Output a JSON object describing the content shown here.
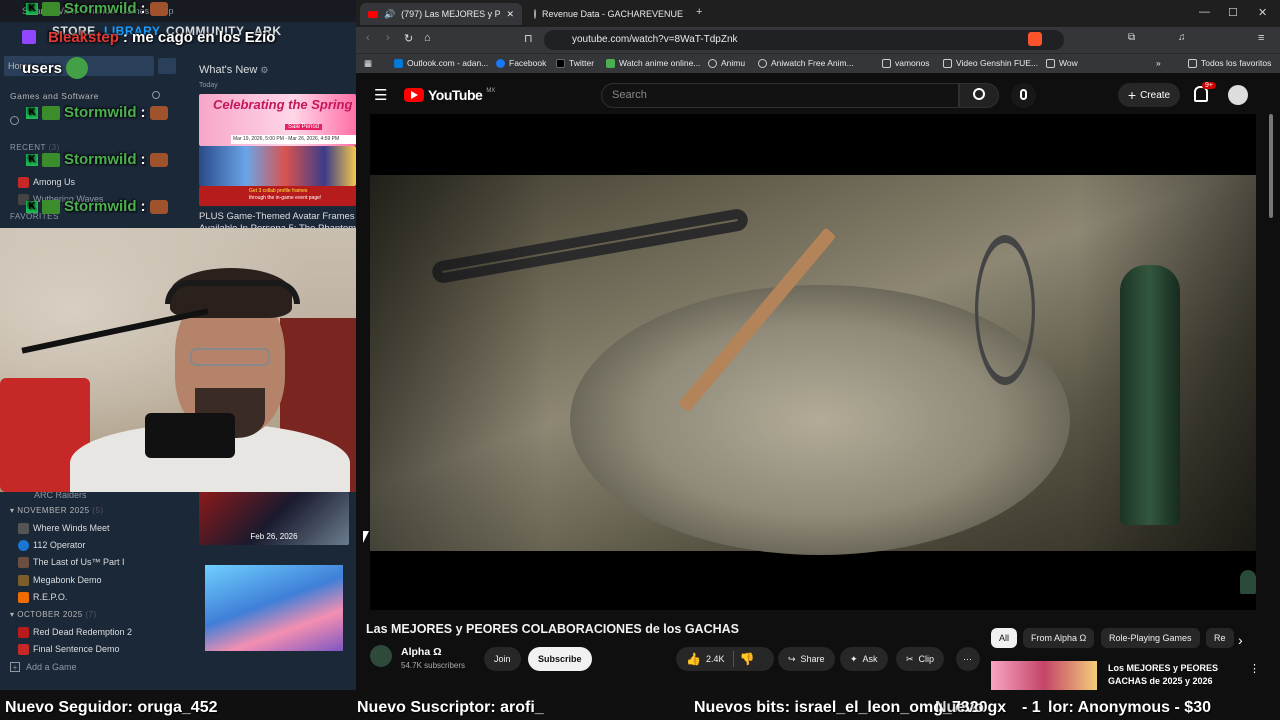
{
  "steam": {
    "menu": [
      "Steam",
      "View",
      "Friends",
      "Games",
      "Help"
    ],
    "nav": {
      "store": "STORE",
      "library": "LIBRARY",
      "community": "COMMUNITY",
      "ark": "ARK"
    },
    "home": "Home",
    "games_section": "Games and Software",
    "recent_label": "RECENT",
    "recent_count": "(3)",
    "recent": [
      "Among Us",
      "Wuthering Waves"
    ],
    "favorites_label": "FAVORITES",
    "whats_new": "What's New",
    "today": "Today",
    "feat1": {
      "title": "Celebrating the Spring",
      "sub": "Sale Period",
      "dates": "Mar 19, 2026, 5:00 PM - Mar 26, 2026, 4:59 PM"
    },
    "feat2": {
      "line1": "Get 3 collab profile frames",
      "line2": "through the in-game event page!",
      "caption": "PLUS Game-Themed Avatar Frames",
      "caption2": "Available In Persona 5: The Phantom"
    },
    "arc": "ARC Raiders",
    "nov_label": "NOVEMBER 2025",
    "nov_count": "(5)",
    "nov": [
      "Where Winds Meet",
      "112 Operator",
      "The Last of Us™ Part I",
      "Megabonk Demo",
      "R.E.P.O."
    ],
    "oct_label": "OCTOBER 2025",
    "oct_count": "(7)",
    "oct": [
      "Red Dead Redemption 2",
      "Final Sentence Demo"
    ],
    "tile_date": "Feb 26, 2026",
    "add_game": "Add a Game"
  },
  "chat": {
    "line1_name": "Bleakstep",
    "line1_msg": ": me cago en los Ezio",
    "line2_msg": "users",
    "stormwild_name": "Stormwild",
    "stormwild_sep": ":"
  },
  "browser": {
    "tab1": "(797) Las MEJORES y PEORES",
    "tab2": "Revenue Data - GACHAREVENUE",
    "url": "youtube.com/watch?v=8WaT-TdpZnk",
    "bookmarks": [
      "Outlook.com - adan...",
      "Facebook",
      "Twitter",
      "Watch anime online...",
      "Animu",
      "Aniwatch Free Anim...",
      "vamonos",
      "Video Genshin FUE...",
      "Wow"
    ],
    "all_bookmarks": "Todos los favoritos"
  },
  "youtube": {
    "logo": "YouTube",
    "region": "MX",
    "search_placeholder": "Search",
    "create": "Create",
    "notif_count": "9+",
    "video_title": "Las MEJORES y PEORES COLABORACIONES de los GACHAS",
    "channel": "Alpha Ω",
    "subs": "54.7K subscribers",
    "join": "Join",
    "subscribe": "Subscribe",
    "likes": "2.4K",
    "share": "Share",
    "ask": "Ask",
    "clip": "Clip",
    "chips": [
      "All",
      "From Alpha Ω",
      "Role-Playing Games",
      "Re"
    ],
    "rec_title_1": "Los MEJORES y PEORES",
    "rec_title_2": "GACHAS de 2025 y 2026"
  },
  "ticker": {
    "follower": "Nuevo Seguidor: oruga_452",
    "subscriber": "Nuevo Suscriptor: arofi_",
    "bits": "Nuevos bits: israel_el_leon_omg_7320gx",
    "donation": "- 1",
    "donation2": "lor: Anonymous - $30",
    "donation_overlap": "Nuevo"
  },
  "colors": {
    "yt_red": "#ff0000",
    "steam_bg": "#1b2838",
    "chat_green": "#4caf50",
    "subscribe_bg": "#f1f1f1"
  }
}
